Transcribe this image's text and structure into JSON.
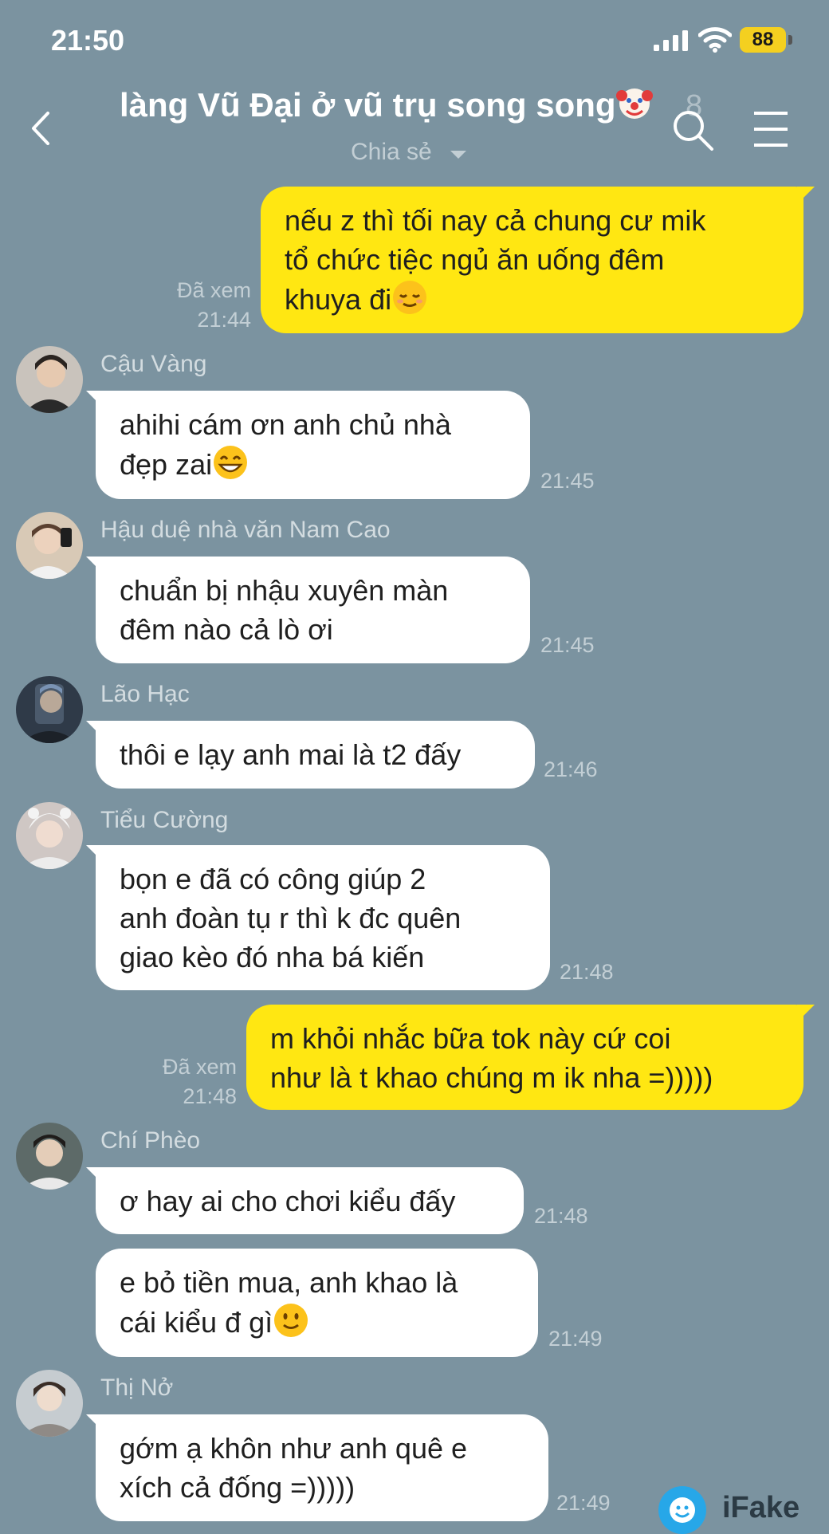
{
  "status_bar": {
    "time": "21:50",
    "battery": "88"
  },
  "header": {
    "title": "làng Vũ Đại ở vũ trụ song song",
    "member_count": "8",
    "share": "Chia sẻ"
  },
  "messages": [
    {
      "type": "out",
      "lines": [
        "nếu z thì tối nay cả chung cư mik",
        "tổ chức tiệc ngủ ăn uống đêm",
        "khuya đi"
      ],
      "emoji": "relieved-emoji",
      "seen": "Đã xem",
      "time": "21:44"
    },
    {
      "type": "in",
      "sender": "Cậu Vàng",
      "lines": [
        "ahihi cám ơn anh chủ nhà",
        "đẹp zai"
      ],
      "emoji": "grin-emoji",
      "time": "21:45"
    },
    {
      "type": "in",
      "sender": "Hậu duệ nhà văn Nam Cao",
      "lines": [
        "chuẩn bị nhậu xuyên màn",
        "đêm nào cả lò ơi"
      ],
      "time": "21:45"
    },
    {
      "type": "in",
      "sender": "Lão Hạc",
      "lines": [
        "thôi e lạy anh mai là t2 đấy"
      ],
      "time": "21:46"
    },
    {
      "type": "in",
      "sender": "Tiểu Cường",
      "lines": [
        "bọn e đã có công giúp 2",
        "anh đoàn tụ r thì k đc quên",
        "giao kèo đó nha bá kiến"
      ],
      "time": "21:48"
    },
    {
      "type": "out",
      "lines": [
        "m khỏi nhắc bữa tok này cứ coi",
        "như là t khao chúng m ik nha =)))))"
      ],
      "seen": "Đã xem",
      "time": "21:48"
    },
    {
      "type": "in",
      "sender": "Chí Phèo",
      "lines": [
        "ơ hay ai cho chơi kiểu đấy"
      ],
      "time": "21:48"
    },
    {
      "type": "in",
      "lines": [
        "e bỏ tiền mua, anh khao là",
        "cái kiểu đ gì"
      ],
      "emoji": "slight-smile-emoji",
      "time": "21:49"
    },
    {
      "type": "in",
      "sender": "Thị Nở",
      "lines": [
        "gớm ạ khôn như anh quê e",
        "xích cả đống =)))))"
      ],
      "time": "21:49"
    }
  ],
  "watermark": "iFake",
  "colors": {
    "background": "#7b93a0",
    "outgoing": "#ffe712",
    "incoming": "#ffffff",
    "battery": "#f4d020"
  }
}
